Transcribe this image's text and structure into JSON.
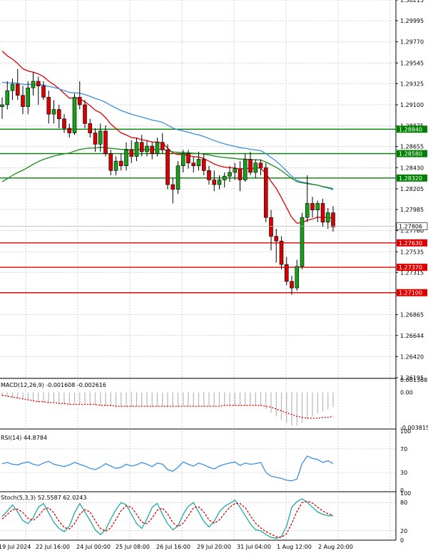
{
  "chart_data": {
    "type": "candlestick",
    "main": {
      "price_ticks": [
        "1.30215",
        "1.29995",
        "1.29770",
        "1.29545",
        "1.29325",
        "1.29100",
        "1.28875",
        "1.28655",
        "1.28430",
        "1.28205",
        "1.27985",
        "1.27760",
        "1.27535",
        "1.27315",
        "1.27090",
        "1.26865",
        "1.26644",
        "1.26420",
        "1.26195"
      ],
      "ylim": [
        1.26195,
        1.30215
      ],
      "horizontal_levels": [
        {
          "label": "1.28840",
          "value": 1.2884,
          "color": "#008000"
        },
        {
          "label": "1.28580",
          "value": 1.2858,
          "color": "#008000"
        },
        {
          "label": "1.28320",
          "value": 1.2832,
          "color": "#008000"
        },
        {
          "label": "1.27630",
          "value": 1.2763,
          "color": "#e00000"
        },
        {
          "label": "1.27370",
          "value": 1.2737,
          "color": "#e00000"
        },
        {
          "label": "1.27100",
          "value": 1.271,
          "color": "#e00000"
        }
      ],
      "current_price": {
        "label": "1.27806",
        "value": 1.27806
      },
      "candles": [
        [
          1.2908,
          1.2918,
          1.2895,
          1.291
        ],
        [
          1.291,
          1.2935,
          1.2905,
          1.2925
        ],
        [
          1.2925,
          1.2938,
          1.2915,
          1.2932
        ],
        [
          1.2932,
          1.2948,
          1.2915,
          1.292
        ],
        [
          1.292,
          1.293,
          1.29,
          1.2908
        ],
        [
          1.2908,
          1.2935,
          1.29,
          1.2928
        ],
        [
          1.2928,
          1.2945,
          1.292,
          1.2935
        ],
        [
          1.2935,
          1.294,
          1.291,
          1.293
        ],
        [
          1.293,
          1.2935,
          1.2915,
          1.2918
        ],
        [
          1.2918,
          1.2925,
          1.289,
          1.29
        ],
        [
          1.29,
          1.2915,
          1.289,
          1.2905
        ],
        [
          1.2905,
          1.291,
          1.2885,
          1.2895
        ],
        [
          1.2895,
          1.29,
          1.288,
          1.2885
        ],
        [
          1.2885,
          1.289,
          1.2875,
          1.288
        ],
        [
          1.288,
          1.2922,
          1.2878,
          1.2918
        ],
        [
          1.2918,
          1.2935,
          1.2905,
          1.291
        ],
        [
          1.291,
          1.2915,
          1.2885,
          1.289
        ],
        [
          1.289,
          1.2895,
          1.2875,
          1.288
        ],
        [
          1.288,
          1.2885,
          1.286,
          1.2868
        ],
        [
          1.2868,
          1.289,
          1.286,
          1.2882
        ],
        [
          1.2882,
          1.2888,
          1.2855,
          1.2858
        ],
        [
          1.2858,
          1.2862,
          1.2835,
          1.284
        ],
        [
          1.284,
          1.2855,
          1.2835,
          1.285
        ],
        [
          1.285,
          1.2858,
          1.284,
          1.2845
        ],
        [
          1.2845,
          1.287,
          1.284,
          1.2862
        ],
        [
          1.2862,
          1.2872,
          1.2848,
          1.2855
        ],
        [
          1.2855,
          1.2875,
          1.285,
          1.287
        ],
        [
          1.287,
          1.2878,
          1.2855,
          1.286
        ],
        [
          1.286,
          1.2872,
          1.2855,
          1.2866
        ],
        [
          1.2866,
          1.287,
          1.2852,
          1.2858
        ],
        [
          1.2858,
          1.2875,
          1.2855,
          1.287
        ],
        [
          1.287,
          1.288,
          1.2858,
          1.2862
        ],
        [
          1.2862,
          1.2868,
          1.282,
          1.2825
        ],
        [
          1.2825,
          1.2832,
          1.2805,
          1.282
        ],
        [
          1.282,
          1.285,
          1.2815,
          1.2845
        ],
        [
          1.2845,
          1.2862,
          1.2838,
          1.2858
        ],
        [
          1.2858,
          1.2862,
          1.2842,
          1.2848
        ],
        [
          1.2848,
          1.2855,
          1.2838,
          1.2845
        ],
        [
          1.2845,
          1.286,
          1.284,
          1.2852
        ],
        [
          1.2852,
          1.2858,
          1.2835,
          1.284
        ],
        [
          1.284,
          1.2845,
          1.2825,
          1.283
        ],
        [
          1.283,
          1.284,
          1.2818,
          1.2825
        ],
        [
          1.2825,
          1.2835,
          1.282,
          1.283
        ],
        [
          1.283,
          1.2838,
          1.2822,
          1.2834
        ],
        [
          1.2834,
          1.2845,
          1.2828,
          1.2838
        ],
        [
          1.2838,
          1.2848,
          1.283,
          1.2842
        ],
        [
          1.2842,
          1.285,
          1.2818,
          1.283
        ],
        [
          1.283,
          1.2858,
          1.2828,
          1.2852
        ],
        [
          1.2852,
          1.286,
          1.2835,
          1.2838
        ],
        [
          1.2838,
          1.2852,
          1.2832,
          1.2848
        ],
        [
          1.2848,
          1.2852,
          1.2835,
          1.2843
        ],
        [
          1.2843,
          1.2848,
          1.2785,
          1.279
        ],
        [
          1.279,
          1.2798,
          1.2755,
          1.277
        ],
        [
          1.277,
          1.2778,
          1.2742,
          1.2765
        ],
        [
          1.2765,
          1.277,
          1.2735,
          1.274
        ],
        [
          1.274,
          1.2748,
          1.2718,
          1.2722
        ],
        [
          1.2722,
          1.2728,
          1.2708,
          1.2715
        ],
        [
          1.2715,
          1.2745,
          1.2712,
          1.2738
        ],
        [
          1.2738,
          1.2795,
          1.2735,
          1.279
        ],
        [
          1.279,
          1.2835,
          1.2785,
          1.2805
        ],
        [
          1.2805,
          1.2812,
          1.279,
          1.2798
        ],
        [
          1.2798,
          1.2808,
          1.2785,
          1.2805
        ],
        [
          1.2805,
          1.281,
          1.278,
          1.2785
        ],
        [
          1.2785,
          1.28,
          1.2778,
          1.2795
        ],
        [
          1.2795,
          1.2802,
          1.2775,
          1.278
        ]
      ]
    },
    "macd": {
      "label": "MACD(12,26,9) -0.001608 -0.002616",
      "ticks": [
        "0.001368",
        "0.00",
        "-0.003815"
      ],
      "ylim": [
        -0.003815,
        0.001368
      ],
      "histogram": [
        -0.0004,
        -0.0005,
        -0.0006,
        -0.0007,
        -0.0008,
        -0.0009,
        -0.001,
        -0.0011,
        -0.0011,
        -0.0012,
        -0.0012,
        -0.0013,
        -0.0013,
        -0.0014,
        -0.0013,
        -0.0013,
        -0.0013,
        -0.0014,
        -0.0014,
        -0.0014,
        -0.0015,
        -0.0015,
        -0.0016,
        -0.0016,
        -0.0016,
        -0.0016,
        -0.0015,
        -0.0015,
        -0.0015,
        -0.0015,
        -0.0015,
        -0.0015,
        -0.0016,
        -0.0016,
        -0.0016,
        -0.0015,
        -0.0015,
        -0.0015,
        -0.0015,
        -0.0015,
        -0.0015,
        -0.0015,
        -0.0014,
        -0.0014,
        -0.0014,
        -0.0014,
        -0.0014,
        -0.0014,
        -0.0014,
        -0.0014,
        -0.0014,
        -0.0018,
        -0.0022,
        -0.0026,
        -0.003,
        -0.0033,
        -0.0036,
        -0.0036,
        -0.0033,
        -0.0029,
        -0.0026,
        -0.0023,
        -0.0021,
        -0.0018,
        -0.0016
      ],
      "signal": [
        -0.0003,
        -0.0004,
        -0.0005,
        -0.0006,
        -0.0007,
        -0.0008,
        -0.0009,
        -0.001,
        -0.001,
        -0.0011,
        -0.0011,
        -0.0012,
        -0.0012,
        -0.0013,
        -0.0013,
        -0.0013,
        -0.0013,
        -0.0013,
        -0.0013,
        -0.0014,
        -0.0014,
        -0.0014,
        -0.0015,
        -0.0015,
        -0.0015,
        -0.0015,
        -0.0015,
        -0.0015,
        -0.0015,
        -0.0015,
        -0.0015,
        -0.0015,
        -0.0015,
        -0.0015,
        -0.0015,
        -0.0015,
        -0.0015,
        -0.0015,
        -0.0015,
        -0.0015,
        -0.0015,
        -0.0015,
        -0.0015,
        -0.0014,
        -0.0014,
        -0.0014,
        -0.0014,
        -0.0014,
        -0.0014,
        -0.0014,
        -0.0014,
        -0.0015,
        -0.0016,
        -0.0018,
        -0.002,
        -0.0022,
        -0.0024,
        -0.0026,
        -0.0027,
        -0.0028,
        -0.0028,
        -0.0028,
        -0.0027,
        -0.0027,
        -0.0026
      ]
    },
    "rsi": {
      "label": "RSI(14) 44.8784",
      "ticks": [
        "100",
        "70",
        "30",
        "0"
      ],
      "ylim": [
        0,
        100
      ],
      "values": [
        45,
        47,
        44,
        43,
        46,
        48,
        44,
        42,
        46,
        49,
        44,
        42,
        40,
        43,
        47,
        44,
        41,
        37,
        35,
        39,
        45,
        41,
        37,
        39,
        44,
        41,
        43,
        47,
        44,
        40,
        46,
        44,
        35,
        32,
        39,
        48,
        44,
        41,
        46,
        43,
        39,
        36,
        41,
        44,
        46,
        48,
        42,
        46,
        44,
        45,
        47,
        30,
        24,
        22,
        20,
        17,
        16,
        19,
        45,
        58,
        54,
        52,
        47,
        50,
        45
      ]
    },
    "stoch": {
      "label": "Stoch(5,3,3) 52.5587 62.0243",
      "ticks": [
        "100",
        "80",
        "20",
        "0"
      ],
      "ylim": [
        0,
        100
      ],
      "k": [
        50,
        62,
        75,
        60,
        42,
        35,
        48,
        70,
        78,
        58,
        38,
        25,
        18,
        30,
        58,
        78,
        60,
        42,
        22,
        12,
        22,
        45,
        65,
        80,
        75,
        55,
        35,
        25,
        45,
        70,
        78,
        55,
        35,
        22,
        30,
        55,
        72,
        80,
        60,
        40,
        28,
        40,
        60,
        72,
        78,
        85,
        70,
        52,
        35,
        22,
        20,
        12,
        6,
        4,
        8,
        30,
        70,
        82,
        88,
        80,
        70,
        60,
        55,
        52,
        52
      ],
      "d": [
        45,
        55,
        65,
        66,
        59,
        46,
        42,
        51,
        65,
        69,
        58,
        40,
        27,
        24,
        35,
        55,
        65,
        60,
        41,
        25,
        19,
        26,
        44,
        63,
        73,
        70,
        55,
        38,
        35,
        47,
        64,
        68,
        56,
        37,
        29,
        36,
        52,
        69,
        71,
        60,
        43,
        36,
        43,
        57,
        70,
        78,
        78,
        69,
        52,
        36,
        26,
        18,
        13,
        7,
        6,
        14,
        36,
        61,
        80,
        83,
        79,
        70,
        62,
        56,
        53
      ]
    },
    "time_labels": [
      "19 Jul 2024",
      "22 Jul 16:00",
      "24 Jul 00:00",
      "25 Jul 08:00",
      "26 Jul 16:00",
      "29 Jul 20:00",
      "31 Jul 04:00",
      "1 Aug 12:00",
      "2 Aug 20:00"
    ]
  }
}
